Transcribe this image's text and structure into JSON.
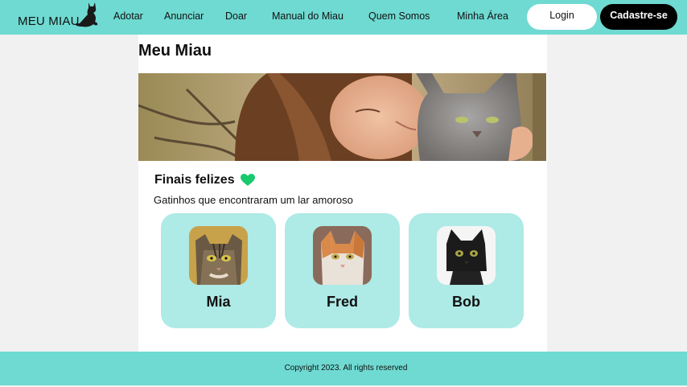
{
  "header": {
    "logo_text": "MEU MIAU",
    "nav": [
      {
        "label": "Adotar"
      },
      {
        "label": "Anunciar"
      },
      {
        "label": "Doar"
      },
      {
        "label": "Manual do Miau"
      },
      {
        "label": "Quem Somos"
      },
      {
        "label": "Minha Área"
      }
    ],
    "login_label": "Login",
    "signup_label": "Cadastre-se"
  },
  "main": {
    "title": "Meu Miau",
    "section_title": "Finais felizes",
    "section_subtitle": "Gatinhos que encontraram um lar amoroso",
    "cards": [
      {
        "name": "Mia"
      },
      {
        "name": "Fred"
      },
      {
        "name": "Bob"
      }
    ]
  },
  "footer": {
    "copyright": "Copyright 2023. All rights reserved"
  },
  "colors": {
    "header_bg": "#6fdad2",
    "card_bg": "#aeeae6",
    "heart": "#18c96e",
    "signup_bg": "#000000"
  },
  "icons": [
    "cat-silhouette-icon",
    "green-heart-icon"
  ]
}
